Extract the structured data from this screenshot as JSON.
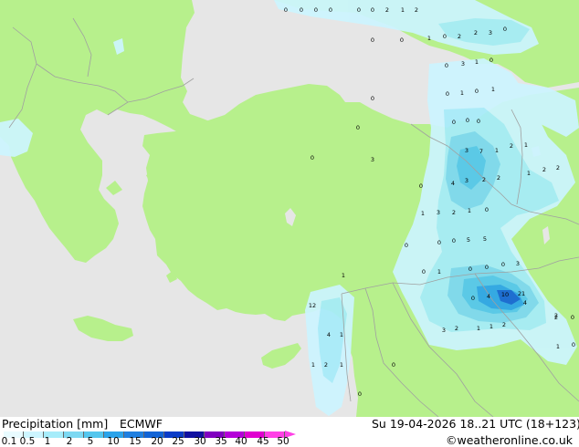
{
  "map": {
    "land_color": "#b7f08c",
    "sea_color": "#e6e6e6",
    "border_color": "#a0a0a0",
    "precip_colors": [
      "#ccf5ff",
      "#a6ecfa",
      "#7dd8f2",
      "#54c6ee",
      "#2ba3ea",
      "#1264d6"
    ],
    "point_values": [
      {
        "v": "0"
      },
      {
        "v": "0"
      },
      {
        "v": "0"
      },
      {
        "v": "0"
      },
      {
        "v": "0"
      },
      {
        "v": "0"
      },
      {
        "v": "2"
      },
      {
        "v": "1"
      },
      {
        "v": "2"
      },
      {
        "v": "0"
      },
      {
        "v": "0"
      },
      {
        "v": "1"
      },
      {
        "v": "0"
      },
      {
        "v": "2"
      },
      {
        "v": "2"
      },
      {
        "v": "3"
      },
      {
        "v": "0"
      },
      {
        "v": "0"
      },
      {
        "v": "3"
      },
      {
        "v": "1"
      },
      {
        "v": "0"
      },
      {
        "v": "0"
      },
      {
        "v": "1"
      },
      {
        "v": "0"
      },
      {
        "v": "1"
      },
      {
        "v": "0"
      },
      {
        "v": "0"
      },
      {
        "v": "0"
      },
      {
        "v": "3"
      },
      {
        "v": "0"
      },
      {
        "v": "0"
      },
      {
        "v": "0"
      },
      {
        "v": "3"
      },
      {
        "v": "7"
      },
      {
        "v": "1"
      },
      {
        "v": "2"
      },
      {
        "v": "1"
      },
      {
        "v": "4"
      },
      {
        "v": "3"
      },
      {
        "v": "2"
      },
      {
        "v": "2"
      },
      {
        "v": "1"
      },
      {
        "v": "2"
      },
      {
        "v": "2"
      },
      {
        "v": "0"
      },
      {
        "v": "1"
      },
      {
        "v": "3"
      },
      {
        "v": "2"
      },
      {
        "v": "1"
      },
      {
        "v": "0"
      },
      {
        "v": "0"
      },
      {
        "v": "0"
      },
      {
        "v": "0"
      },
      {
        "v": "5"
      },
      {
        "v": "5"
      },
      {
        "v": "0"
      },
      {
        "v": "1"
      },
      {
        "v": "0"
      },
      {
        "v": "0"
      },
      {
        "v": "0"
      },
      {
        "v": "3"
      },
      {
        "v": "1"
      },
      {
        "v": "0"
      },
      {
        "v": "4"
      },
      {
        "v": "10"
      },
      {
        "v": "21"
      },
      {
        "v": "12"
      },
      {
        "v": "3"
      },
      {
        "v": "2"
      },
      {
        "v": "2"
      },
      {
        "v": "4"
      },
      {
        "v": "1"
      },
      {
        "v": "2"
      },
      {
        "v": "1"
      },
      {
        "v": "1"
      },
      {
        "v": "0"
      },
      {
        "v": "2"
      },
      {
        "v": "1"
      },
      {
        "v": "1"
      },
      {
        "v": "0"
      },
      {
        "v": "1"
      },
      {
        "v": "0"
      },
      {
        "v": "2"
      },
      {
        "v": "4"
      },
      {
        "v": "0"
      },
      {
        "v": "1"
      }
    ]
  },
  "footer": {
    "title": "Precipitation [mm]",
    "model": "ECMWF",
    "datetime": "Su 19-04-2026 18..21 UTC (18+123)",
    "credit": "©weatheronline.co.uk",
    "legend_ticks": [
      "0.1",
      "0.5",
      "1",
      "2",
      "5",
      "10",
      "15",
      "20",
      "25",
      "30",
      "35",
      "40",
      "45",
      "50"
    ],
    "legend_colors": [
      "#e8fbff",
      "#ccf5ff",
      "#a6ecfa",
      "#7dd8f2",
      "#54c6ee",
      "#2ba3ea",
      "#1f7fe0",
      "#1264d6",
      "#0a3cc8",
      "#1010a0",
      "#8000c0",
      "#b400d8",
      "#e000d0",
      "#ff40e6"
    ]
  }
}
